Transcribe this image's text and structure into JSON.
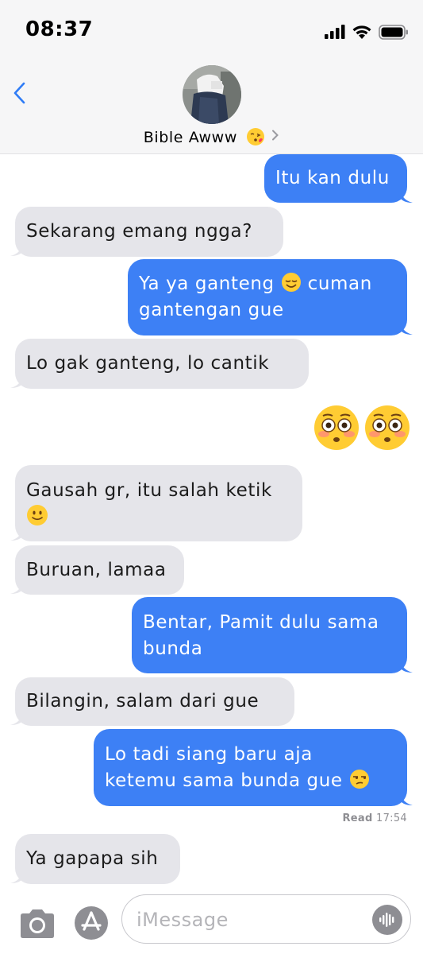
{
  "status_bar": {
    "time": "08:37"
  },
  "header": {
    "contact_name": "Bible Awww"
  },
  "icons": {
    "back": "chevron-left-icon",
    "contact_emoji": "face-blowing-kiss-icon",
    "contact_chevron": "chevron-right-icon",
    "camera": "camera-icon",
    "apps": "app-store-icon",
    "audio": "audio-waveform-icon"
  },
  "colors": {
    "outgoing_bubble": "#3d80f5",
    "incoming_bubble": "#e5e5ea",
    "accent": "#2f7cf6"
  },
  "messages": [
    {
      "dir": "out",
      "lines": [
        "Itu kan dulu"
      ]
    },
    {
      "dir": "in",
      "lines": [
        "Sekarang emang ngga?"
      ]
    },
    {
      "dir": "out",
      "lines": [
        "Ya ya ganteng",
        "cuman",
        "gantengan gue"
      ]
    },
    {
      "dir": "in",
      "lines": [
        "Lo gak ganteng, lo cantik"
      ]
    },
    {
      "dir": "out",
      "lines": []
    },
    {
      "dir": "in",
      "lines": [
        "Gausah gr, itu salah ketik"
      ]
    },
    {
      "dir": "in",
      "lines": [
        "Buruan, lamaa"
      ]
    },
    {
      "dir": "out",
      "lines": [
        "Bentar, Pamit dulu sama",
        "bunda"
      ]
    },
    {
      "dir": "in",
      "lines": [
        "Bilangin, salam dari gue"
      ]
    },
    {
      "dir": "out",
      "lines": [
        "Lo tadi siang baru aja",
        "ketemu sama bunda gue"
      ]
    },
    {
      "dir": "in",
      "lines": [
        "Ya gapapa sih"
      ]
    }
  ],
  "read_receipt": {
    "label": "Read",
    "time": "17:54"
  },
  "composer": {
    "placeholder": "iMessage"
  }
}
